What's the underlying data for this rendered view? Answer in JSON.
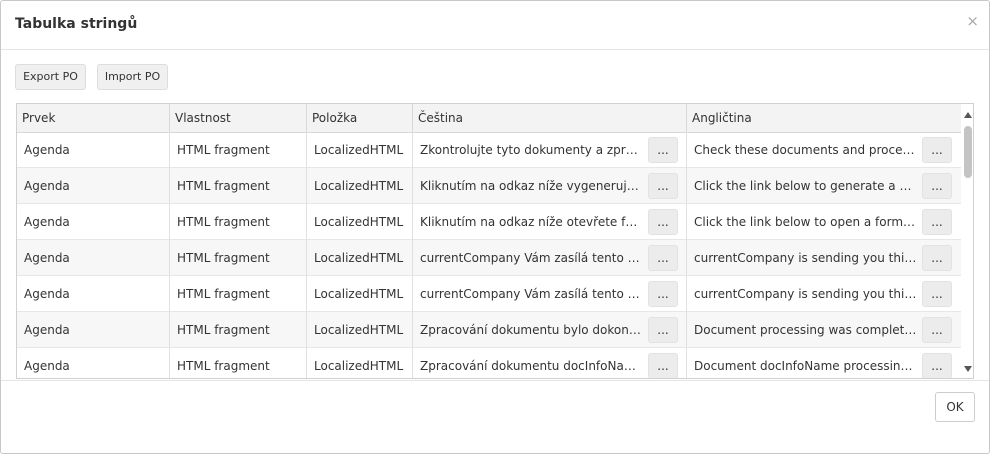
{
  "dialog": {
    "title": "Tabulka stringů",
    "close_glyph": "×",
    "ok_label": "OK"
  },
  "toolbar": {
    "export_label": "Export PO",
    "import_label": "Import PO"
  },
  "table": {
    "columns": [
      "Prvek",
      "Vlastnost",
      "Položka",
      "Čeština",
      "Angličtina"
    ],
    "ellipsis_label": "...",
    "rows": [
      [
        "Agenda",
        "HTML fragment",
        "LocalizedHTML",
        "Zkontrolujte tyto dokumenty a zpracujte je",
        "Check these documents and process them"
      ],
      [
        "Agenda",
        "HTML fragment",
        "LocalizedHTML",
        "Kliknutím na odkaz níže vygenerujete dokument",
        "Click the link below to generate a one-time"
      ],
      [
        "Agenda",
        "HTML fragment",
        "LocalizedHTML",
        "Kliknutím na odkaz níže otevřete formulář",
        "Click the link below to open a form where"
      ],
      [
        "Agenda",
        "HTML fragment",
        "LocalizedHTML",
        "currentCompany Vám zasílá tento e-mail",
        "currentCompany is sending you this email"
      ],
      [
        "Agenda",
        "HTML fragment",
        "LocalizedHTML",
        "currentCompany Vám zasílá tento e-mail",
        "currentCompany is sending you this email"
      ],
      [
        "Agenda",
        "HTML fragment",
        "LocalizedHTML",
        "Zpracování dokumentu bylo dokončeno",
        "Document processing was completed"
      ],
      [
        "Agenda",
        "HTML fragment",
        "LocalizedHTML",
        "Zpracování dokumentu docInfoName bylo",
        "Document docInfoName processing was"
      ]
    ]
  }
}
